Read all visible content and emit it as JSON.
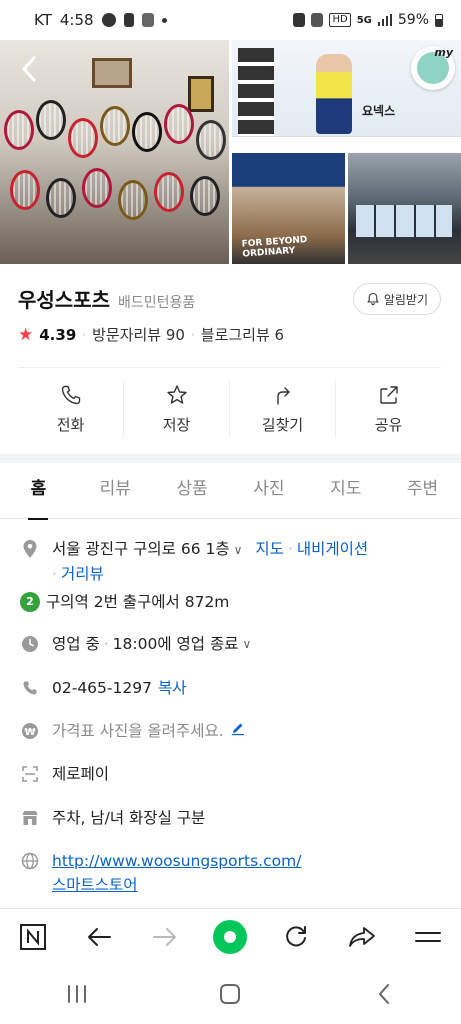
{
  "status_bar": {
    "carrier": "KT",
    "time": "4:58",
    "network": "5G",
    "battery": "59%"
  },
  "gallery": {
    "photo_brand_text": "요넥스",
    "photo_banner_text": "FOR BEYOND ORDINARY"
  },
  "place": {
    "name": "우성스포츠",
    "category": "배드민턴용품",
    "alarm_label": "알림받기",
    "rating": "4.39",
    "visitor_reviews": "방문자리뷰 90",
    "blog_reviews": "블로그리뷰 6"
  },
  "actions": [
    {
      "label": "전화",
      "icon": "phone-icon"
    },
    {
      "label": "저장",
      "icon": "star-icon"
    },
    {
      "label": "길찾기",
      "icon": "directions-icon"
    },
    {
      "label": "공유",
      "icon": "share-icon"
    }
  ],
  "tabs": [
    "홈",
    "리뷰",
    "상품",
    "사진",
    "지도",
    "주변"
  ],
  "info": {
    "address": "서울 광진구 구의로 66 1층",
    "map_link": "지도",
    "navigation_link": "내비게이션",
    "roadview_link": "거리뷰",
    "subway_line": "2",
    "subway_text": "구의역 2번 출구에서 872m",
    "hours_status": "영업 중",
    "hours_close": "18:00에 영업 종료",
    "phone": "02-465-1297",
    "copy_label": "복사",
    "price_prompt": "가격표 사진을 올려주세요.",
    "payment": "제로페이",
    "facilities": "주차, 남/녀 화장실 구분",
    "website": "http://www.woosungsports.com/",
    "smartstore": "스마트스토어"
  },
  "colors": {
    "link": "#0b62c8",
    "naver_green": "#03c75a",
    "star": "#ff3c46",
    "subway_line2": "#33a23d"
  }
}
